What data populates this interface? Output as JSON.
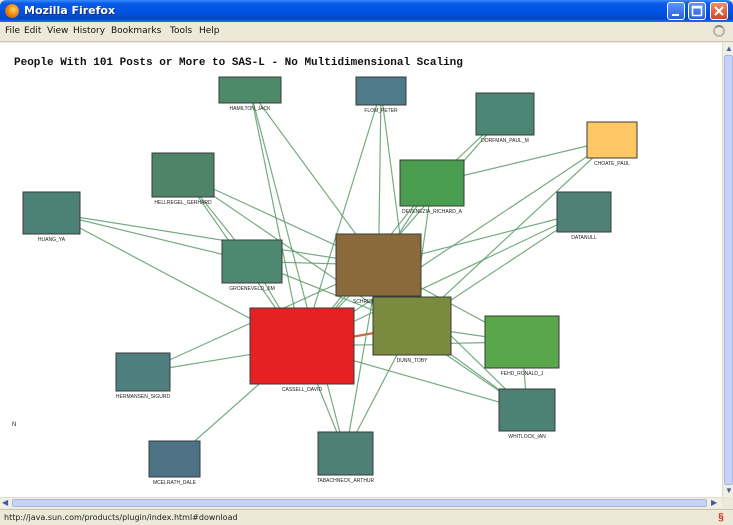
{
  "window": {
    "title": "Mozilla Firefox",
    "app_icon": "firefox-icon"
  },
  "menubar": {
    "items": [
      "File",
      "Edit",
      "View",
      "History",
      "Bookmarks",
      "Tools",
      "Help"
    ]
  },
  "page": {
    "heading": "People With 101 Posts or More to SAS-L - No Multidimensional Scaling",
    "side_marker": "N"
  },
  "status": {
    "url": "http://java.sun.com/products/plugin/index.html#download",
    "icon": "java-plugin-icon"
  },
  "graph": {
    "nodes": [
      {
        "id": "hamilton",
        "label": "HAMILTON_JACK",
        "color": "#4c8a6a"
      },
      {
        "id": "flom",
        "label": "FLOM_PETER",
        "color": "#4f7a8a"
      },
      {
        "id": "dorfman",
        "label": "DORFMAN_PAUL_M",
        "color": "#4c8574"
      },
      {
        "id": "choate",
        "label": "CHOATE_PAUL",
        "color": "#ffc864"
      },
      {
        "id": "helbrecht",
        "label": "HELLREGEL_GERHARD",
        "color": "#4e8468"
      },
      {
        "id": "devenezia",
        "label": "DEVENEZIA_RICHARD_A",
        "color": "#489e4e"
      },
      {
        "id": "huang",
        "label": "HUANG_YA",
        "color": "#4c8275"
      },
      {
        "id": "datanull",
        "label": "DATANULL",
        "color": "#4e8278"
      },
      {
        "id": "groeneveld",
        "label": "GROENEVELD_JIM",
        "color": "#4e8870"
      },
      {
        "id": "schreier",
        "label": "SCHREIER_HOWARD",
        "color": "#8a6a3a"
      },
      {
        "id": "dunn",
        "label": "DUNN_TOBY",
        "color": "#7a8a3e"
      },
      {
        "id": "cassell",
        "label": "CASSELL_DAVID",
        "color": "#e42222"
      },
      {
        "id": "fehd",
        "label": "FEHD_RONALD_J",
        "color": "#5aa64a"
      },
      {
        "id": "hermansen",
        "label": "HERMANSEN_SIGURD",
        "color": "#4e7e7e"
      },
      {
        "id": "whitlock",
        "label": "WHITLOCK_IAN",
        "color": "#4c8274"
      },
      {
        "id": "mcelrath",
        "label": "MCELRATH_DALE",
        "color": "#4e7285"
      },
      {
        "id": "tabachneck",
        "label": "TABACHNECK_ARTHUR",
        "color": "#4e8078"
      }
    ],
    "edges": [
      [
        "cassell",
        "schreier"
      ],
      [
        "cassell",
        "dunn"
      ],
      [
        "cassell",
        "devenezia"
      ],
      [
        "cassell",
        "choate"
      ],
      [
        "cassell",
        "helbrecht"
      ],
      [
        "cassell",
        "groeneveld"
      ],
      [
        "cassell",
        "hermansen"
      ],
      [
        "cassell",
        "mcelrath"
      ],
      [
        "cassell",
        "tabachneck"
      ],
      [
        "cassell",
        "whitlock"
      ],
      [
        "cassell",
        "fehd"
      ],
      [
        "cassell",
        "huang"
      ],
      [
        "cassell",
        "datanull"
      ],
      [
        "cassell",
        "hamilton"
      ],
      [
        "cassell",
        "flom"
      ],
      [
        "cassell",
        "dorfman"
      ],
      [
        "schreier",
        "dunn"
      ],
      [
        "schreier",
        "huang"
      ],
      [
        "schreier",
        "helbrecht"
      ],
      [
        "schreier",
        "hamilton"
      ],
      [
        "schreier",
        "flom"
      ],
      [
        "schreier",
        "devenezia"
      ],
      [
        "schreier",
        "datanull"
      ],
      [
        "schreier",
        "fehd"
      ],
      [
        "schreier",
        "whitlock"
      ],
      [
        "schreier",
        "groeneveld"
      ],
      [
        "schreier",
        "hermansen"
      ],
      [
        "schreier",
        "tabachneck"
      ],
      [
        "dunn",
        "devenezia"
      ],
      [
        "dunn",
        "fehd"
      ],
      [
        "dunn",
        "whitlock"
      ],
      [
        "dunn",
        "tabachneck"
      ],
      [
        "dunn",
        "groeneveld"
      ],
      [
        "dunn",
        "datanull"
      ],
      [
        "dunn",
        "flom"
      ],
      [
        "dunn",
        "choate"
      ],
      [
        "devenezia",
        "dorfman"
      ],
      [
        "devenezia",
        "choate"
      ],
      [
        "groeneveld",
        "helbrecht"
      ],
      [
        "fehd",
        "whitlock"
      ],
      [
        "hamilton",
        "tabachneck"
      ],
      [
        "helbrecht",
        "whitlock"
      ],
      [
        "huang",
        "groeneveld"
      ]
    ]
  }
}
